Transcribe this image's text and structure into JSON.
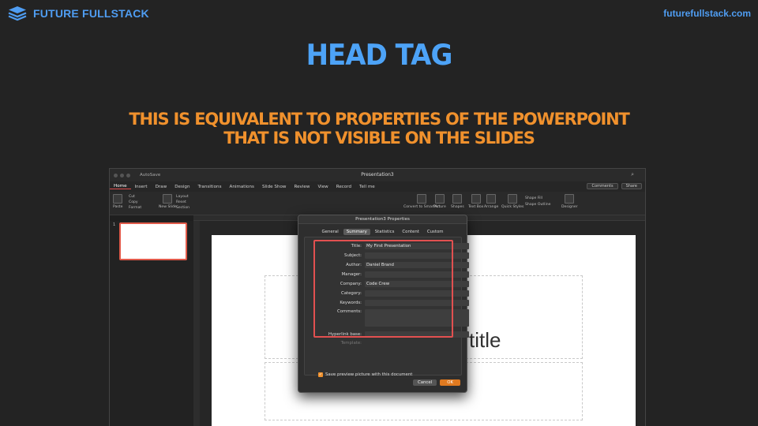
{
  "brand": {
    "name": "FUTURE FULLSTACK",
    "site": "futurefullstack.com",
    "color": "#4f9df2"
  },
  "headline": "HEAD TAG",
  "subtitle": {
    "line1": "THIS IS EQUIVALENT TO PROPERTIES OF THE POWERPOINT",
    "line2": "THAT IS NOT VISIBLE ON THE SLIDES"
  },
  "app": {
    "title": "Presentation3",
    "autosave": "AutoSave",
    "tabs": [
      "Home",
      "Insert",
      "Draw",
      "Design",
      "Transitions",
      "Animations",
      "Slide Show",
      "Review",
      "View",
      "Record",
      "Tell me"
    ],
    "actions": {
      "comments": "Comments",
      "share": "Share"
    },
    "ribbon": [
      "Paste",
      "New Slide",
      "Convert to SmartArt",
      "Picture",
      "Shapes",
      "Text Box",
      "Arrange",
      "Quick Styles",
      "Designer"
    ],
    "clipboard": [
      "Cut",
      "Copy",
      "Format"
    ],
    "slide_layout": [
      "Layout",
      "Reset",
      "Section"
    ],
    "shape_fmt": [
      "Shape Fill",
      "Shape Outline"
    ],
    "slide_number": "1",
    "placeholder_text": "title"
  },
  "dialog": {
    "title": "Presentation3 Properties",
    "tabs": [
      "General",
      "Summary",
      "Statistics",
      "Content",
      "Custom"
    ],
    "selected_tab": "Summary",
    "fields": [
      {
        "label": "Title:",
        "value": "My First Presentation"
      },
      {
        "label": "Subject:",
        "value": ""
      },
      {
        "label": "Author:",
        "value": "Daniel Brand"
      },
      {
        "label": "Manager:",
        "value": ""
      },
      {
        "label": "Company:",
        "value": "Code Crew"
      },
      {
        "label": "Category:",
        "value": ""
      },
      {
        "label": "Keywords:",
        "value": ""
      },
      {
        "label": "Comments:",
        "value": ""
      },
      {
        "label": "Hyperlink base:",
        "value": ""
      },
      {
        "label": "Template:",
        "value": ""
      }
    ],
    "checkbox": "Save preview picture with this document",
    "cancel": "Cancel",
    "ok": "OK",
    "highlight_color": "#e25050"
  }
}
